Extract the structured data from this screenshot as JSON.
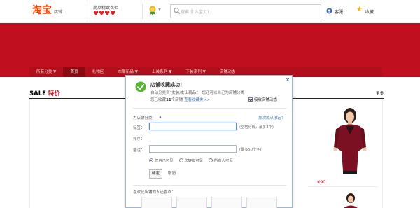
{
  "header": {
    "logo_main": "淘宝",
    "logo_sub": "店铺",
    "shop_name": "尚点精致衣柜",
    "hearts": "♥♥♥♥",
    "search_placeholder": "搜索 什么宝贝?",
    "customer_service": "客服",
    "favorite": "收藏"
  },
  "nav": {
    "items": [
      {
        "label": "所有分类 ▼",
        "active": false
      },
      {
        "label": "首页",
        "active": true
      },
      {
        "label": "礼物区",
        "active": false
      },
      {
        "label": "本周新品 ▼",
        "active": false
      },
      {
        "label": "上装系列 ▼",
        "active": false
      },
      {
        "label": "下装系列 ▼",
        "active": false
      },
      {
        "label": "店铺动态",
        "active": false
      }
    ]
  },
  "section": {
    "title_en": "SALE",
    "title_cn": "特价",
    "more": "更多",
    "price": "¥90"
  },
  "dialog": {
    "close": "×",
    "title": "店铺收藏成功！",
    "desc": "自动分类到“女装/女士精品”，您还可以自己为店铺分类",
    "count_prefix": "您已收藏",
    "count": "11",
    "count_suffix": "个店铺",
    "view_link": "查看收藏夹>>",
    "receive_label": "接收店铺动态",
    "group_label": "为店铺分类",
    "help_link": "那次默认收起?",
    "tag_label": "标签：",
    "tag_value": "",
    "tag_hint": "(空格分隔，最多3个)",
    "sort_label": "排序：",
    "note_label": "备注：",
    "note_value": "",
    "note_hint": "(最多50个字)",
    "radios": [
      {
        "label": "仅自己可见",
        "checked": true
      },
      {
        "label": "您好友可见",
        "checked": false
      },
      {
        "label": "所有人可见",
        "checked": false
      }
    ],
    "confirm": "确定",
    "cancel": "取消",
    "suggest_label": "喜欢此店铺的人还喜欢："
  },
  "colors": {
    "brand": "#ff4400",
    "banner_red": "#c0101f",
    "success_green": "#55b52e",
    "link_blue": "#3a6fb0"
  }
}
